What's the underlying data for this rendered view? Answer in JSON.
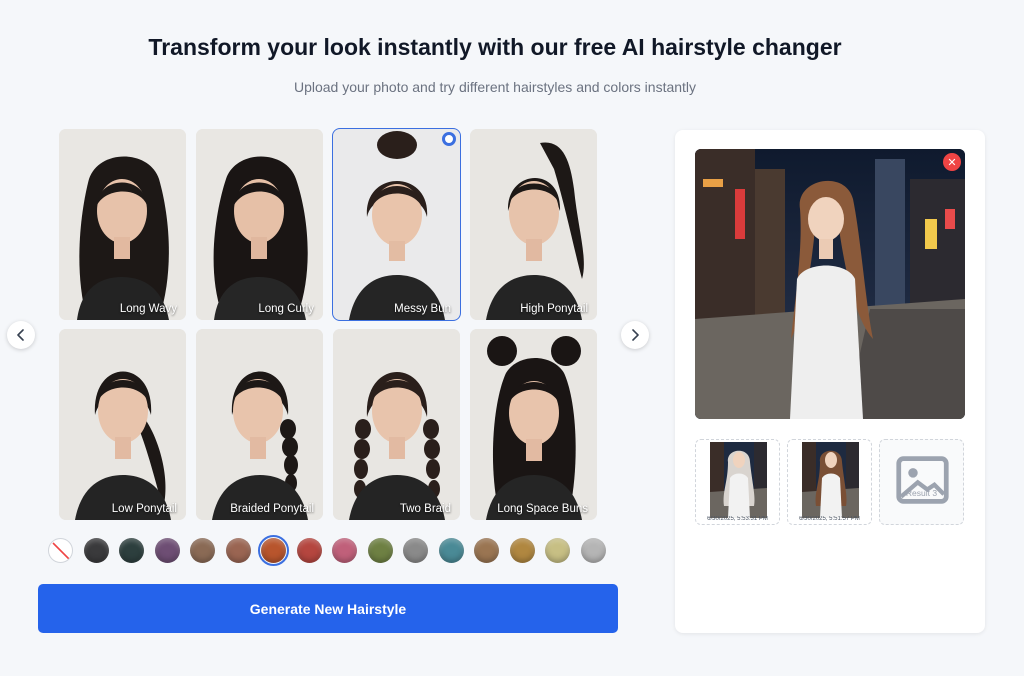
{
  "header": {
    "title": "Transform your look instantly with our free AI hairstyle changer",
    "subtitle": "Upload your photo and try different hairstyles and colors instantly"
  },
  "carousel": {
    "prev_icon": "chevron-left-icon",
    "next_icon": "chevron-right-icon"
  },
  "hairstyles": [
    {
      "label": "Long Wavy",
      "selected": false
    },
    {
      "label": "Long Curly",
      "selected": false
    },
    {
      "label": "Messy Bun",
      "selected": true
    },
    {
      "label": "High Ponytail",
      "selected": false
    },
    {
      "label": "Low Ponytail",
      "selected": false
    },
    {
      "label": "Braided Ponytail",
      "selected": false
    },
    {
      "label": "Two Braid",
      "selected": false
    },
    {
      "label": "Long Space Buns",
      "selected": false
    }
  ],
  "colors": [
    "none",
    "#3a3a3c",
    "#2d3f3e",
    "#6e4e74",
    "#8a6a55",
    "#9a6552",
    "#b8552d",
    "#b5463f",
    "#c0607a",
    "#6e8043",
    "#8a8a8a",
    "#4a8a96",
    "#9a7552",
    "#b08740",
    "#c7bf84",
    "#b5b5b5"
  ],
  "selected_color": "#b8552d",
  "generate_button": "Generate New Hairstyle",
  "results": {
    "close_icon": "close-icon",
    "thumbnails": [
      {
        "time": "6/30/2025, 5:53:31 PM"
      },
      {
        "time": "6/30/2025, 5:51:57 PM"
      }
    ],
    "empty_slot_label": "Result 3",
    "empty_slot_icon": "image-icon"
  }
}
